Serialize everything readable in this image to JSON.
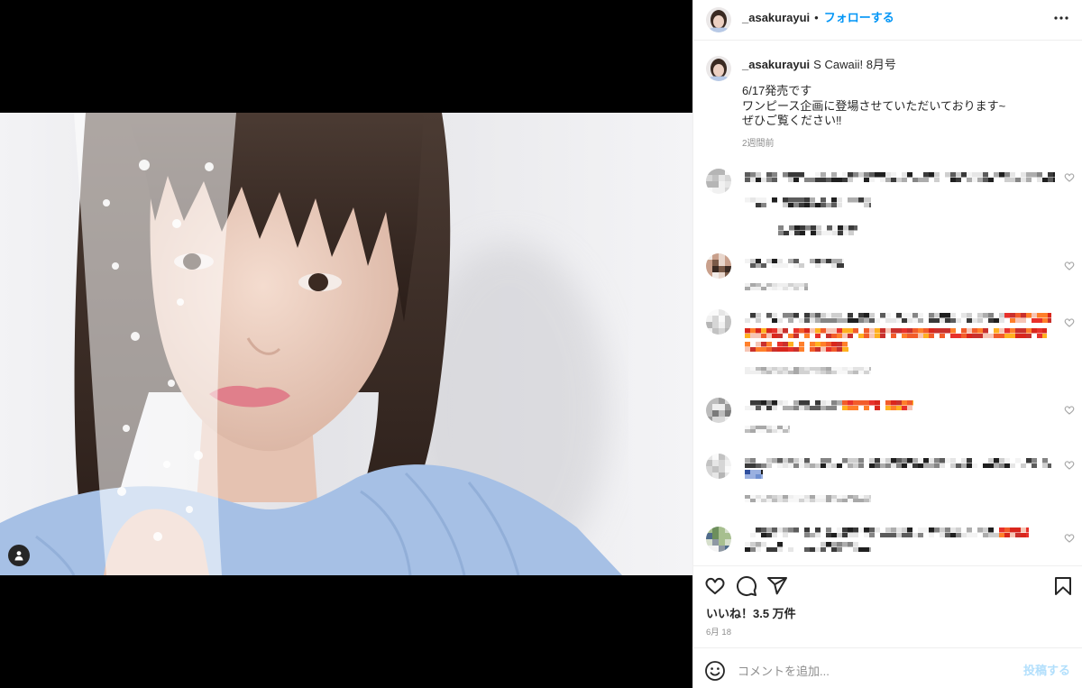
{
  "post": {
    "author": {
      "username": "_asakurayui"
    },
    "separator": "•",
    "follow_label": "フォローする",
    "caption": {
      "username": "_asakurayui",
      "text_first": "S Cawaii! 8月号",
      "lines": [
        "6/17発売です",
        "ワンピース企画に登場させていただいております~",
        "ぜひご覧ください‼"
      ],
      "time": "2週間前"
    },
    "comments": [
      {
        "like_icon": "heart-icon"
      },
      {
        "like_icon": "heart-icon"
      },
      {
        "like_icon": "heart-icon"
      },
      {
        "like_icon": "heart-icon"
      },
      {
        "like_icon": "heart-icon"
      },
      {
        "like_icon": "heart-icon"
      }
    ],
    "likes_text": "いいね！3.5 万件",
    "date": "6月 18",
    "comment_input": {
      "placeholder": "コメントを追加...",
      "post_label": "投稿する"
    }
  },
  "icons": {
    "more": "more-options-icon",
    "user_tag": "user-tag-icon",
    "like": "heart-icon",
    "comment": "comment-icon",
    "share": "share-icon",
    "save": "bookmark-icon",
    "emoji": "emoji-icon"
  },
  "colors": {
    "accent": "#0095f6",
    "post_button": "#b2dffc",
    "text": "#262626",
    "secondary": "#8e8e8e",
    "divider": "#efefef",
    "media_background": "#000000"
  }
}
